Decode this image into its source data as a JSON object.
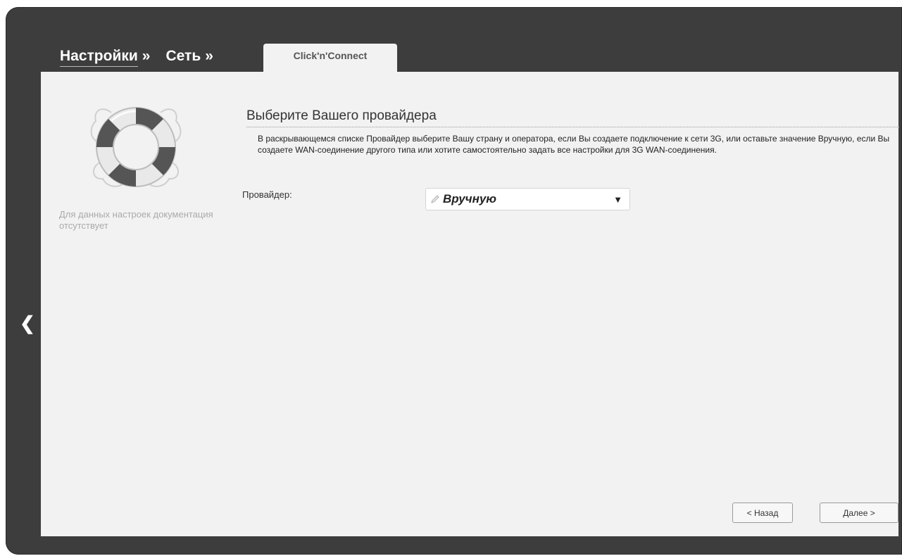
{
  "breadcrumb": {
    "items": [
      {
        "label": "Настройки",
        "sep": "»"
      },
      {
        "label": "Сеть",
        "sep": "»"
      }
    ],
    "active_tab": "Click'n'Connect"
  },
  "sidebar": {
    "help_text": "Для данных настроек документация отсутствует"
  },
  "section": {
    "title": "Выберите Вашего провайдера",
    "description": "В раскрывающемся списке Провайдер выберите Вашу страну и оператора, если Вы создаете подключение к сети 3G, или оставьте значение Вручную, если Вы создаете WAN-соединение другого типа или хотите самостоятельно задать все настройки для 3G WAN-соединения."
  },
  "provider": {
    "label": "Провайдер:",
    "value": "Вручную"
  },
  "buttons": {
    "back": "< Назад",
    "next": "Далее >"
  },
  "colors": {
    "frame": "#3d3d3d",
    "panel": "#f2f2f2",
    "help_text": "#aaaaaa"
  },
  "icons": {
    "help": "lifebuoy-icon",
    "collapse": "chevron-left-icon",
    "select_value": "pencil-icon",
    "select_caret": "caret-down-icon"
  }
}
